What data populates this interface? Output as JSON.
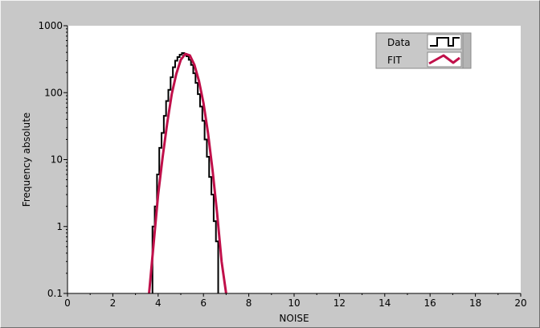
{
  "chart_data": {
    "type": "line",
    "title": "",
    "xlabel": "NOISE",
    "ylabel": "Frequency absolute",
    "xlim": [
      0,
      20
    ],
    "ylim": [
      0.1,
      1000
    ],
    "yscale": "log",
    "grid": false,
    "legend_position": "top-right",
    "x_ticks": [
      "0",
      "2",
      "4",
      "6",
      "8",
      "10",
      "12",
      "14",
      "16",
      "18",
      "20"
    ],
    "y_ticks": [
      "0.1",
      "1",
      "10",
      "100",
      "1000"
    ],
    "colors": {
      "plot_bg": "#ffffff",
      "frame": "#c8c8c8",
      "data": "#000000",
      "fit": "#c0104a"
    },
    "series": [
      {
        "name": "Data",
        "style": "step",
        "x": [
          3.8,
          3.9,
          4.0,
          4.1,
          4.2,
          4.3,
          4.4,
          4.5,
          4.6,
          4.7,
          4.8,
          4.9,
          5.0,
          5.1,
          5.2,
          5.3,
          5.4,
          5.5,
          5.6,
          5.7,
          5.8,
          5.9,
          6.0,
          6.1,
          6.2,
          6.3,
          6.4,
          6.5,
          6.6
        ],
        "y": [
          1,
          2,
          6,
          15,
          25,
          45,
          75,
          110,
          170,
          240,
          300,
          340,
          370,
          390,
          380,
          350,
          310,
          260,
          195,
          140,
          95,
          62,
          38,
          20,
          11,
          5.5,
          3,
          1.2,
          0.6
        ]
      },
      {
        "name": "FIT",
        "style": "line",
        "x": [
          3.6,
          3.8,
          4.0,
          4.2,
          4.4,
          4.6,
          4.8,
          5.0,
          5.2,
          5.4,
          5.6,
          5.8,
          6.0,
          6.2,
          6.4,
          6.6,
          6.8,
          7.0
        ],
        "y": [
          0.1,
          0.55,
          3,
          11,
          35,
          95,
          190,
          310,
          380,
          360,
          260,
          150,
          70,
          25,
          7,
          1.6,
          0.3,
          0.1
        ]
      }
    ]
  },
  "legend": {
    "items": [
      {
        "label": "Data",
        "icon": "step-line-icon"
      },
      {
        "label": "FIT",
        "icon": "zigzag-line-icon"
      }
    ]
  }
}
